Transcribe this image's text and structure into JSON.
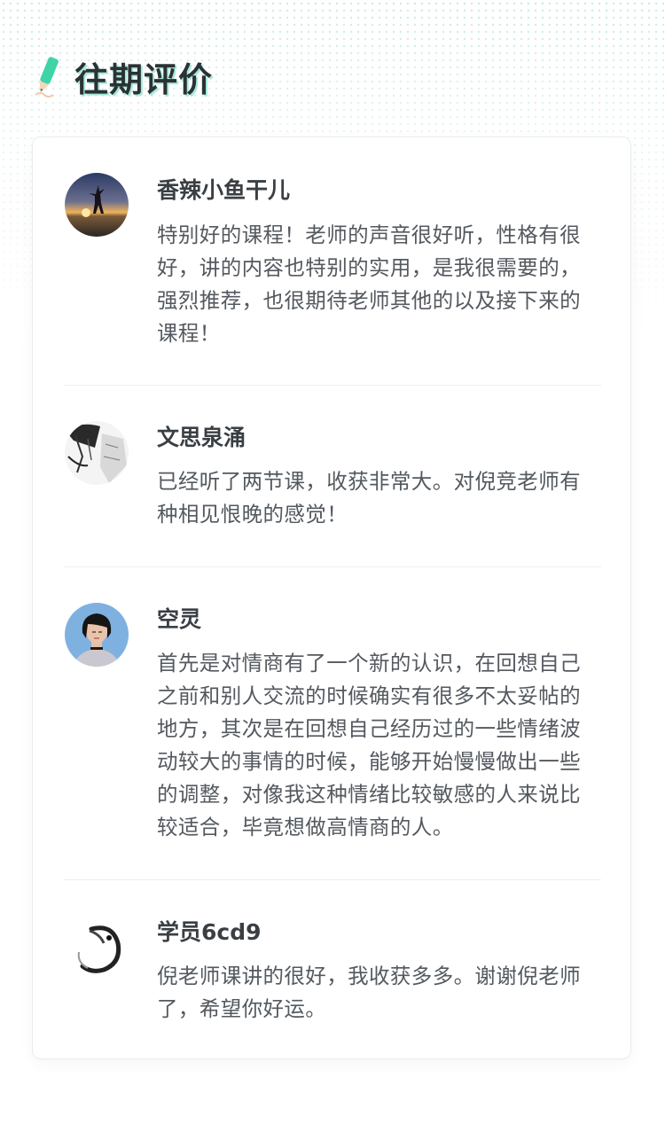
{
  "header": {
    "title": "往期评价",
    "icon": "pencil-icon",
    "accent_color": "#3fd3a8"
  },
  "reviews": [
    {
      "name": "香辣小鱼干儿",
      "avatar": "sunset-silhouette-avatar",
      "comment": "特别好的课程！老师的声音很好听，性格有很好，讲的内容也特别的实用，是我很需要的，强烈推荐，也很期待老师其他的以及接下来的课程！"
    },
    {
      "name": "文思泉涌",
      "avatar": "sketch-portrait-avatar",
      "comment": "已经听了两节课，收获非常大。对倪竞老师有种相见恨晚的感觉！"
    },
    {
      "name": "空灵",
      "avatar": "girl-portrait-avatar",
      "comment": "首先是对情商有了一个新的认识，在回想自己之前和别人交流的时候确实有很多不太妥帖的地方，其次是在回想自己经历过的一些情绪波动较大的事情的时候，能够开始慢慢做出一些的调整，对像我这种情绪比较敏感的人来说比较适合，毕竟想做高情商的人。"
    },
    {
      "name": "学员6cd9",
      "avatar": "ink-swirl-avatar",
      "comment": "倪老师课讲的很好，我收获多多。谢谢倪老师了，希望你好运。"
    }
  ]
}
